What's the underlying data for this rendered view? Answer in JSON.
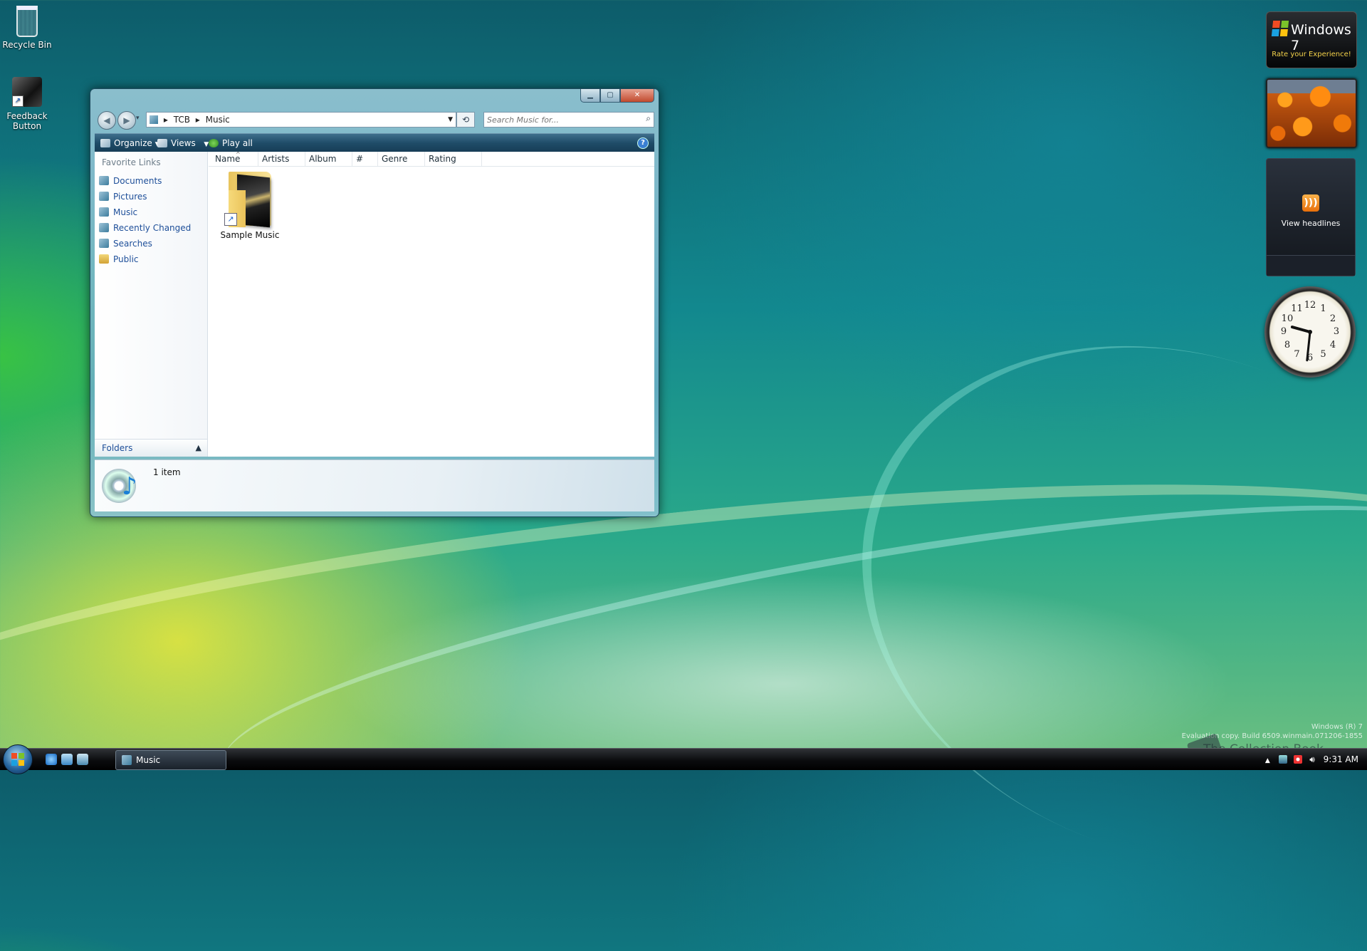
{
  "desktop": {
    "icons": [
      {
        "label": "Recycle Bin"
      },
      {
        "label": "Feedback Button"
      }
    ]
  },
  "window": {
    "address": {
      "root": "TCB",
      "current": "Music"
    },
    "search_placeholder": "Search Music for...",
    "toolbar": {
      "organize": "Organize",
      "views": "Views",
      "play_all": "Play all"
    },
    "favorite_links_title": "Favorite Links",
    "favorite_links": [
      "Documents",
      "Pictures",
      "Music",
      "Recently Changed",
      "Searches",
      "Public"
    ],
    "folders_label": "Folders",
    "columns": [
      "Name",
      "Artists",
      "Album",
      "#",
      "Genre",
      "Rating"
    ],
    "items": [
      {
        "name": "Sample Music"
      }
    ],
    "details": {
      "count_text": "1 item"
    }
  },
  "gadgets": {
    "windows7": {
      "title": "Windows 7",
      "subtitle": "Rate your Experience!"
    },
    "feed": {
      "label": "View headlines"
    },
    "clock": {
      "hour": 9,
      "minute": 31
    }
  },
  "taskbar": {
    "tasks": [
      {
        "label": "Music"
      }
    ],
    "time": "9:31 AM"
  },
  "watermark": {
    "line1": "Windows (R) 7",
    "line2": "Evaluation copy. Build 6509.winmain.071206-1855",
    "brand": "The Collection Book"
  },
  "colors": {
    "accent": "#1e4f99",
    "toolbar": "#1f4c68"
  }
}
